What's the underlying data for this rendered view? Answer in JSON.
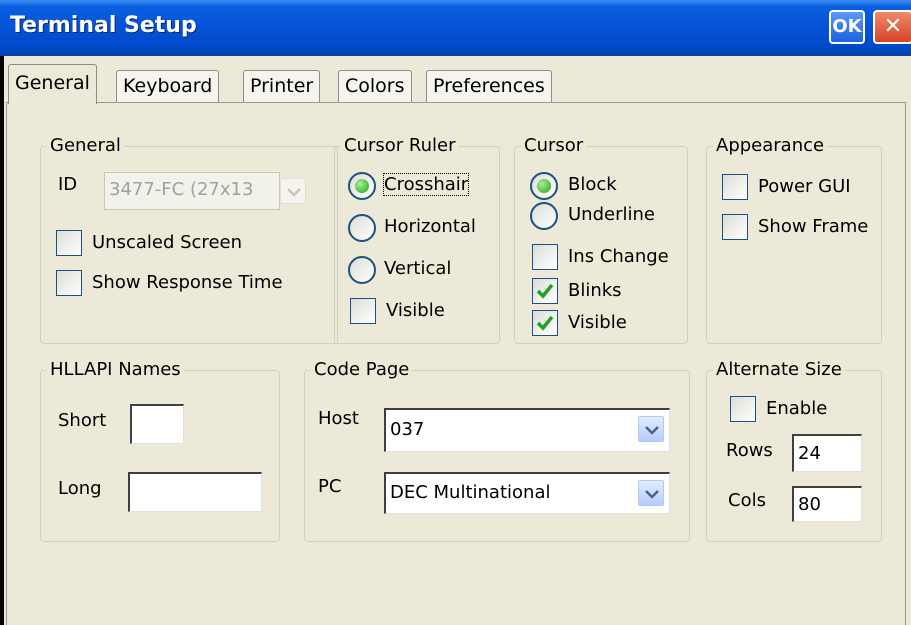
{
  "window": {
    "title": "Terminal Setup",
    "ok_label": "OK",
    "close_label": "✕"
  },
  "tabs": [
    "General",
    "Keyboard",
    "Printer",
    "Colors",
    "Preferences"
  ],
  "active_tab": "General",
  "general": {
    "legend": "General",
    "id_label": "ID",
    "id_value": "3477-FC (27x13",
    "unscaled_screen": {
      "label": "Unscaled Screen",
      "checked": false
    },
    "show_response_time": {
      "label": "Show Response Time",
      "checked": false
    }
  },
  "cursor_ruler": {
    "legend": "Cursor Ruler",
    "options": [
      "Crosshair",
      "Horizontal",
      "Vertical"
    ],
    "selected": "Crosshair",
    "visible": {
      "label": "Visible",
      "checked": false
    }
  },
  "cursor": {
    "legend": "Cursor",
    "options": [
      "Block",
      "Underline"
    ],
    "selected": "Block",
    "ins_change": {
      "label": "Ins Change",
      "checked": false
    },
    "blinks": {
      "label": "Blinks",
      "checked": true
    },
    "visible": {
      "label": "Visible",
      "checked": true
    }
  },
  "appearance": {
    "legend": "Appearance",
    "power_gui": {
      "label": "Power GUI",
      "checked": false
    },
    "show_frame": {
      "label": "Show Frame",
      "checked": false
    }
  },
  "hllapi": {
    "legend": "HLLAPI Names",
    "short_label": "Short",
    "short_value": "",
    "long_label": "Long",
    "long_value": ""
  },
  "code_page": {
    "legend": "Code Page",
    "host_label": "Host",
    "host_value": "037",
    "pc_label": "PC",
    "pc_value": "DEC Multinational"
  },
  "alternate_size": {
    "legend": "Alternate Size",
    "enable": {
      "label": "Enable",
      "checked": false
    },
    "rows_label": "Rows",
    "rows_value": "24",
    "cols_label": "Cols",
    "cols_value": "80"
  },
  "colors": {
    "titlebar": "#0552d6",
    "radio_selected": "#21a121",
    "check_mark": "#21a121"
  }
}
